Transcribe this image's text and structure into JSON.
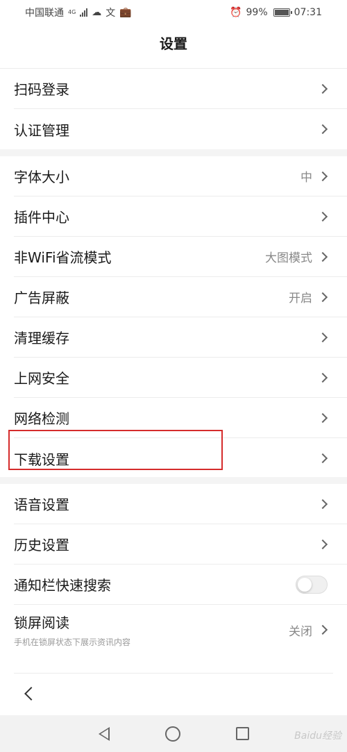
{
  "status_bar": {
    "carrier": "中国联通",
    "network_type": "4G",
    "battery_percent": "99%",
    "time": "07:31",
    "icons": [
      "signal-icon",
      "cloud-download-icon",
      "translate-icon",
      "briefcase-icon",
      "alarm-icon",
      "battery-icon"
    ]
  },
  "header": {
    "title": "设置"
  },
  "sections": [
    {
      "items": [
        {
          "label": "扫码登录"
        },
        {
          "label": "认证管理"
        }
      ]
    },
    {
      "items": [
        {
          "label": "字体大小",
          "value": "中"
        },
        {
          "label": "插件中心"
        },
        {
          "label": "非WiFi省流模式",
          "value": "大图模式"
        },
        {
          "label": "广告屏蔽",
          "value": "开启"
        },
        {
          "label": "清理缓存"
        },
        {
          "label": "上网安全"
        },
        {
          "label": "网络检测"
        },
        {
          "label": "下载设置",
          "highlighted": true
        }
      ]
    },
    {
      "items": [
        {
          "label": "语音设置"
        },
        {
          "label": "历史设置"
        },
        {
          "label": "通知栏快速搜索",
          "toggle": false
        },
        {
          "label": "锁屏阅读",
          "subtitle": "手机在锁屏状态下展示资讯内容",
          "value": "关闭"
        }
      ]
    }
  ],
  "colors": {
    "highlight_border": "#d52b2b",
    "section_gap": "#f4f4f4",
    "nav_bar": "#f2f2f2"
  },
  "watermark": "Baidu经验"
}
